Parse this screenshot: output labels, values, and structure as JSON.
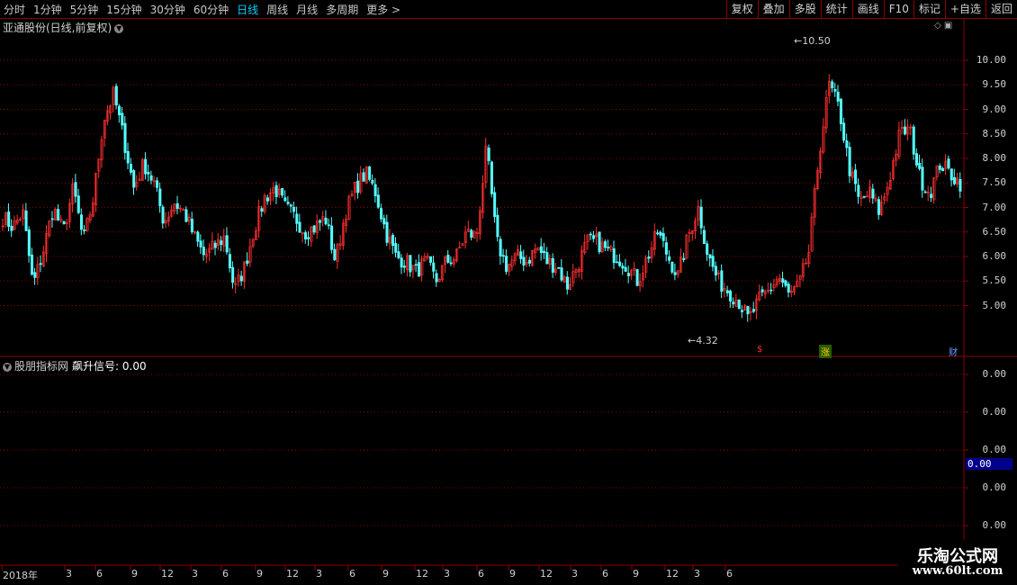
{
  "toolbar": {
    "periods": [
      "分时",
      "1分钟",
      "5分钟",
      "15分钟",
      "30分钟",
      "60分钟",
      "日线",
      "周线",
      "月线",
      "多周期",
      "更多 >"
    ],
    "active_period": "日线",
    "right_buttons": [
      "复权",
      "叠加",
      "多股",
      "统计",
      "画线",
      "F10",
      "标记",
      "+自选",
      "返回"
    ]
  },
  "chart": {
    "title": "亚通股份(日线,前复权)",
    "price_labels": [
      "10.00",
      "9.50",
      "9.00",
      "8.50",
      "8.00",
      "7.50",
      "7.00",
      "6.50",
      "6.00",
      "5.50",
      "5.00"
    ],
    "high_label": "10.50",
    "low_label": "4.32",
    "marker_labels": [
      "$",
      "涨",
      "财"
    ]
  },
  "indicator": {
    "name": "股朋指标网",
    "signal_label": "飙升信号: 0.00",
    "axis_labels": [
      "0.00",
      "0.00",
      "0.00",
      "0.00",
      "0.00"
    ],
    "current_value": "0.00"
  },
  "x_axis": {
    "labels": [
      "2018年",
      "3",
      "6",
      "9",
      "12",
      "3",
      "6",
      "9",
      "12",
      "3",
      "6",
      "9",
      "12",
      "3",
      "6",
      "9",
      "12",
      "3",
      "6",
      "9",
      "12",
      "3",
      "6"
    ]
  },
  "watermark": {
    "line1": "乐淘公式网",
    "line2": "www.60lt.com"
  },
  "colors": {
    "up": "#ff3030",
    "down": "#54ffff",
    "grid": "#8b0000",
    "active": "#00d0ff"
  },
  "chart_data": {
    "type": "candlestick",
    "title": "亚通股份(日线,前复权)",
    "ylim": [
      4.0,
      11.0
    ],
    "series_approx_close": [
      6.8,
      6.6,
      6.9,
      5.4,
      6.1,
      7.0,
      6.5,
      7.4,
      6.3,
      7.2,
      8.8,
      9.3,
      8.4,
      7.4,
      7.9,
      7.5,
      6.7,
      7.1,
      6.9,
      6.4,
      6.0,
      6.2,
      6.4,
      5.3,
      5.8,
      6.6,
      7.2,
      7.4,
      7.0,
      6.8,
      6.5,
      6.6,
      6.8,
      5.9,
      6.9,
      7.4,
      7.7,
      7.3,
      6.5,
      6.0,
      5.9,
      5.7,
      5.9,
      5.5,
      5.9,
      6.0,
      6.5,
      6.4,
      8.2,
      6.3,
      5.8,
      6.0,
      5.9,
      6.2,
      5.9,
      5.8,
      5.4,
      5.8,
      6.3,
      6.3,
      6.1,
      6.0,
      5.8,
      5.5,
      6.0,
      6.5,
      6.0,
      5.6,
      6.4,
      7.0,
      6.0,
      5.5,
      5.3,
      5.1,
      4.7,
      5.1,
      5.3,
      5.6,
      5.2,
      5.4,
      6.1,
      8.1,
      9.5,
      9.0,
      7.8,
      7.1,
      7.3,
      6.9,
      7.6,
      8.5,
      8.6,
      7.6,
      7.3,
      7.9,
      7.7,
      7.5
    ]
  }
}
